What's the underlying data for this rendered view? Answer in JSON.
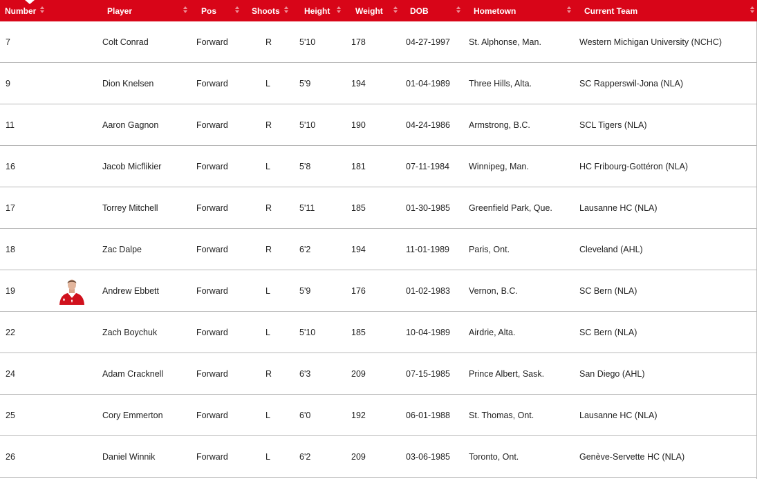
{
  "colors": {
    "header_bg": "#d80518",
    "header_text": "#ffffff",
    "row_border": "#b8b8b8",
    "text": "#222222"
  },
  "table": {
    "headers": {
      "number": "Number",
      "player": "Player",
      "pos": "Pos",
      "shoots": "Shoots",
      "height": "Height",
      "weight": "Weight",
      "dob": "DOB",
      "hometown": "Hometown",
      "current_team": "Current Team"
    },
    "rows": [
      {
        "number": "7",
        "player": "Colt Conrad",
        "pos": "Forward",
        "shoots": "R",
        "height": "5'10",
        "weight": "178",
        "dob": "04-27-1997",
        "hometown": "St. Alphonse, Man.",
        "team": "Western Michigan University (NCHC)"
      },
      {
        "number": "9",
        "player": "Dion Knelsen",
        "pos": "Forward",
        "shoots": "L",
        "height": "5'9",
        "weight": "194",
        "dob": "01-04-1989",
        "hometown": "Three Hills, Alta.",
        "team": "SC Rapperswil-Jona (NLA)"
      },
      {
        "number": "11",
        "player": "Aaron Gagnon",
        "pos": "Forward",
        "shoots": "R",
        "height": "5'10",
        "weight": "190",
        "dob": "04-24-1986",
        "hometown": "Armstrong, B.C.",
        "team": "SCL Tigers (NLA)"
      },
      {
        "number": "16",
        "player": "Jacob Micflikier",
        "pos": "Forward",
        "shoots": "L",
        "height": "5'8",
        "weight": "181",
        "dob": "07-11-1984",
        "hometown": "Winnipeg, Man.",
        "team": "HC Fribourg-Gottéron (NLA)"
      },
      {
        "number": "17",
        "player": "Torrey Mitchell",
        "pos": "Forward",
        "shoots": "R",
        "height": "5'11",
        "weight": "185",
        "dob": "01-30-1985",
        "hometown": "Greenfield Park, Que.",
        "team": "Lausanne HC (NLA)"
      },
      {
        "number": "18",
        "player": "Zac Dalpe",
        "pos": "Forward",
        "shoots": "R",
        "height": "6'2",
        "weight": "194",
        "dob": "11-01-1989",
        "hometown": "Paris, Ont.",
        "team": "Cleveland (AHL)"
      },
      {
        "number": "19",
        "player": "Andrew Ebbett",
        "pos": "Forward",
        "shoots": "L",
        "height": "5'9",
        "weight": "176",
        "dob": "01-02-1983",
        "hometown": "Vernon, B.C.",
        "team": "SC Bern (NLA)",
        "has_photo": true
      },
      {
        "number": "22",
        "player": "Zach Boychuk",
        "pos": "Forward",
        "shoots": "L",
        "height": "5'10",
        "weight": "185",
        "dob": "10-04-1989",
        "hometown": "Airdrie, Alta.",
        "team": "SC Bern (NLA)"
      },
      {
        "number": "24",
        "player": "Adam Cracknell",
        "pos": "Forward",
        "shoots": "R",
        "height": "6'3",
        "weight": "209",
        "dob": "07-15-1985",
        "hometown": "Prince Albert, Sask.",
        "team": "San Diego (AHL)"
      },
      {
        "number": "25",
        "player": "Cory Emmerton",
        "pos": "Forward",
        "shoots": "L",
        "height": "6'0",
        "weight": "192",
        "dob": "06-01-1988",
        "hometown": "St. Thomas, Ont.",
        "team": "Lausanne HC (NLA)"
      },
      {
        "number": "26",
        "player": "Daniel Winnik",
        "pos": "Forward",
        "shoots": "L",
        "height": "6'2",
        "weight": "209",
        "dob": "03-06-1985",
        "hometown": "Toronto, Ont.",
        "team": "Genève-Servette HC (NLA)"
      }
    ]
  }
}
